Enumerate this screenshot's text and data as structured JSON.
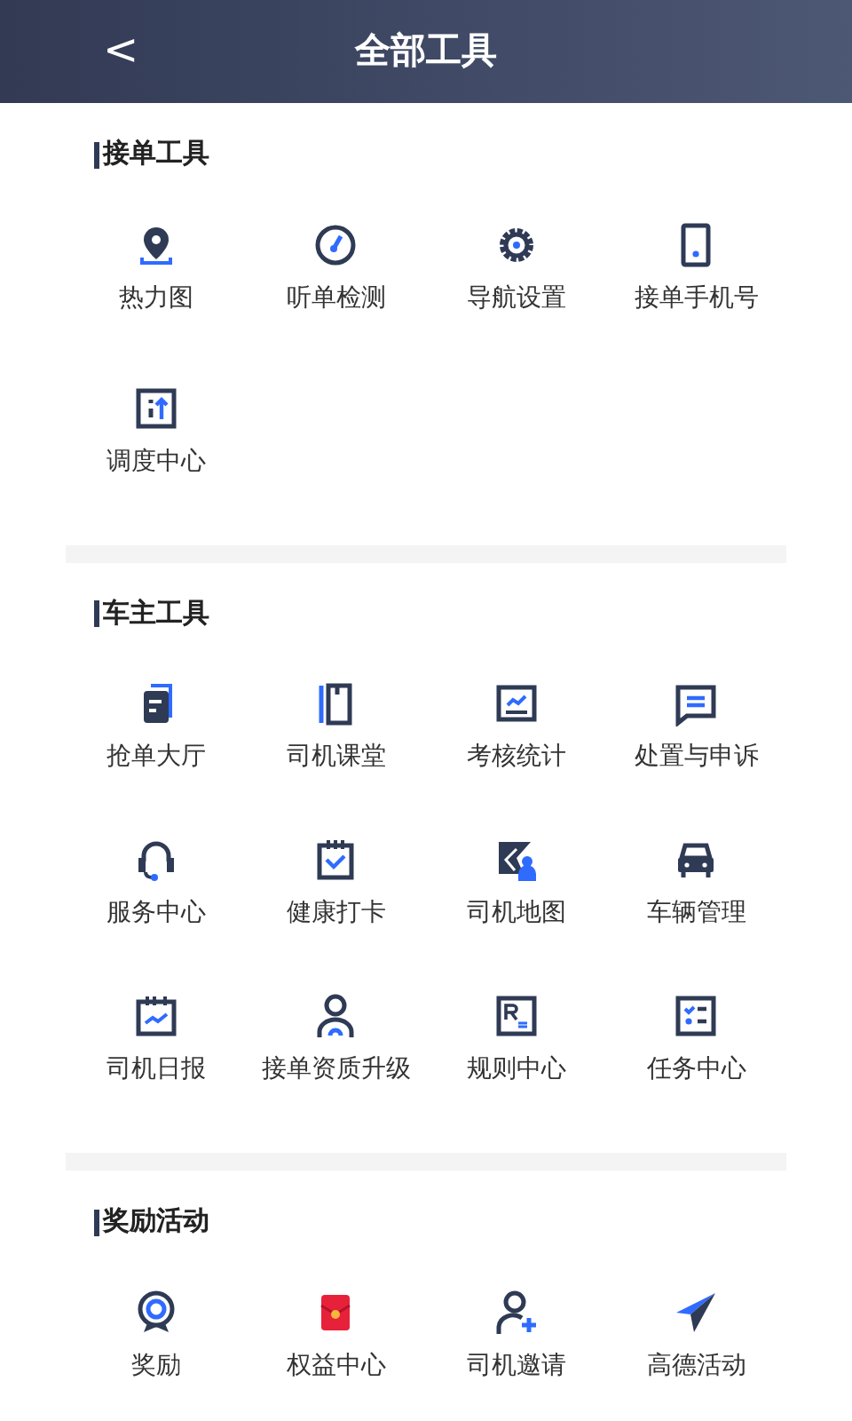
{
  "header": {
    "back": "<",
    "title": "全部工具"
  },
  "sections": [
    {
      "title": "接单工具",
      "items": [
        {
          "label": "热力图"
        },
        {
          "label": "听单检测"
        },
        {
          "label": "导航设置"
        },
        {
          "label": "接单手机号"
        },
        {
          "label": "调度中心"
        }
      ]
    },
    {
      "title": "车主工具",
      "items": [
        {
          "label": "抢单大厅"
        },
        {
          "label": "司机课堂"
        },
        {
          "label": "考核统计"
        },
        {
          "label": "处置与申诉"
        },
        {
          "label": "服务中心"
        },
        {
          "label": "健康打卡"
        },
        {
          "label": "司机地图"
        },
        {
          "label": "车辆管理"
        },
        {
          "label": "司机日报"
        },
        {
          "label": "接单资质升级"
        },
        {
          "label": "规则中心"
        },
        {
          "label": "任务中心"
        }
      ]
    },
    {
      "title": "奖励活动",
      "items": [
        {
          "label": "奖励"
        },
        {
          "label": "权益中心"
        },
        {
          "label": "司机邀请"
        },
        {
          "label": "高德活动"
        }
      ]
    }
  ]
}
